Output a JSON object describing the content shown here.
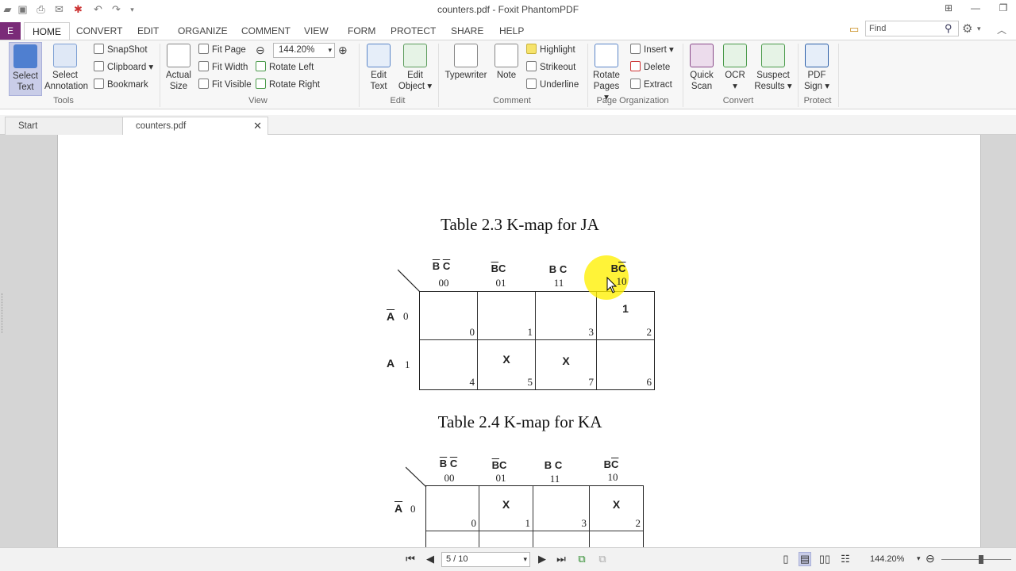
{
  "window": {
    "title": "counters.pdf - Foxit PhantomPDF"
  },
  "menu": {
    "file_label": "E",
    "tabs": [
      "HOME",
      "CONVERT",
      "EDIT",
      "ORGANIZE",
      "COMMENT",
      "VIEW",
      "FORM",
      "PROTECT",
      "SHARE",
      "HELP"
    ],
    "active_tab": "HOME"
  },
  "search": {
    "placeholder": "Find"
  },
  "ribbon": {
    "tools": {
      "select_text": "Select Text",
      "select_annotation": "Select Annotation",
      "snapshot": "SnapShot",
      "clipboard": "Clipboard",
      "bookmark": "Bookmark",
      "group": "Tools"
    },
    "view": {
      "actual_size": "Actual Size",
      "fit_page": "Fit Page",
      "fit_width": "Fit Width",
      "fit_visible": "Fit Visible",
      "zoom_value": "144.20%",
      "rotate_left": "Rotate Left",
      "rotate_right": "Rotate Right",
      "group": "View"
    },
    "edit": {
      "edit_text": "Edit Text",
      "edit_object": "Edit Object",
      "group": "Edit"
    },
    "comment": {
      "typewriter": "Typewriter",
      "note": "Note",
      "highlight": "Highlight",
      "strikeout": "Strikeout",
      "underline": "Underline",
      "group": "Comment"
    },
    "organize": {
      "rotate_pages": "Rotate Pages",
      "insert": "Insert",
      "delete": "Delete",
      "extract": "Extract",
      "group": "Page Organization"
    },
    "convert": {
      "quick_scan": "Quick Scan",
      "ocr": "OCR",
      "suspect_results": "Suspect Results",
      "group": "Convert"
    },
    "protect": {
      "pdf_sign": "PDF Sign",
      "group": "Protect"
    }
  },
  "doc_tabs": {
    "start": "Start",
    "active": "counters.pdf"
  },
  "document": {
    "table1": {
      "title": "Table 2.3 K-map for JA",
      "col_heads": [
        {
          "b": "B",
          "c": "C",
          "b_bar": true,
          "c_bar": true,
          "code": "00"
        },
        {
          "b": "B",
          "c": "C",
          "b_bar": true,
          "c_bar": false,
          "code": "01"
        },
        {
          "b": "B",
          "c": "C",
          "b_bar": false,
          "c_bar": false,
          "code": "11"
        },
        {
          "b": "B",
          "c": "C",
          "b_bar": false,
          "c_bar": true,
          "code": "10"
        }
      ],
      "rows": [
        {
          "label": "A",
          "bar": true,
          "code": "0",
          "cells": [
            {
              "val": "",
              "num": "0"
            },
            {
              "val": "",
              "num": "1"
            },
            {
              "val": "",
              "num": "3"
            },
            {
              "val": "1",
              "num": "2"
            }
          ]
        },
        {
          "label": "A",
          "bar": false,
          "code": "1",
          "cells": [
            {
              "val": "",
              "num": "4"
            },
            {
              "val": "X",
              "num": "5"
            },
            {
              "val": "X",
              "num": "7"
            },
            {
              "val": "",
              "num": "6"
            }
          ]
        }
      ]
    },
    "table2": {
      "title": "Table 2.4 K-map for KA",
      "col_heads": [
        {
          "b": "B",
          "c": "C",
          "b_bar": true,
          "c_bar": true,
          "code": "00"
        },
        {
          "b": "B",
          "c": "C",
          "b_bar": true,
          "c_bar": false,
          "code": "01"
        },
        {
          "b": "B",
          "c": "C",
          "b_bar": false,
          "c_bar": false,
          "code": "11"
        },
        {
          "b": "B",
          "c": "C",
          "b_bar": false,
          "c_bar": true,
          "code": "10"
        }
      ],
      "rows": [
        {
          "label": "A",
          "bar": true,
          "code": "0",
          "cells": [
            {
              "val": "",
              "num": "0"
            },
            {
              "val": "X",
              "num": "1"
            },
            {
              "val": "",
              "num": "3"
            },
            {
              "val": "X",
              "num": "2"
            }
          ]
        }
      ]
    }
  },
  "statusbar": {
    "page_indicator": "5 / 10",
    "zoom": "144.20%"
  }
}
